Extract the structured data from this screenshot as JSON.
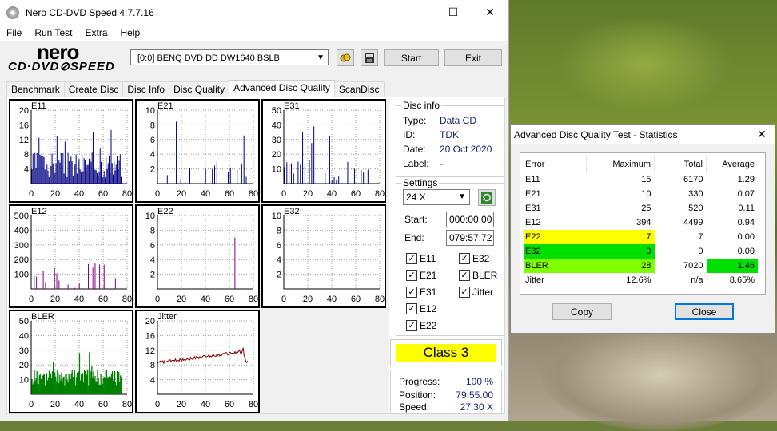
{
  "app": {
    "title": "Nero CD-DVD Speed 4.7.7.16",
    "logo_top": "nero",
    "logo_bottom": "CD·DVD⊘SPEED"
  },
  "window_controls": {
    "minimize": "—",
    "maximize": "☐",
    "close": "✕"
  },
  "menu": [
    "File",
    "Run Test",
    "Extra",
    "Help"
  ],
  "drive": {
    "selected": "[0:0]   BENQ DVD DD DW1640 BSLB"
  },
  "buttons": {
    "start": "Start",
    "exit": "Exit"
  },
  "tabs": [
    "Benchmark",
    "Create Disc",
    "Disc Info",
    "Disc Quality",
    "Advanced Disc Quality",
    "ScanDisc"
  ],
  "active_tab": 4,
  "disc_info": {
    "legend": "Disc info",
    "type_label": "Type:",
    "type": "Data CD",
    "id_label": "ID:",
    "id": "TDK",
    "date_label": "Date:",
    "date": "20 Oct 2020",
    "label_label": "Label:",
    "label": "-"
  },
  "settings": {
    "legend": "Settings",
    "speed": "24 X",
    "start_label": "Start:",
    "start": "000:00.00",
    "end_label": "End:",
    "end": "079:57.72",
    "checks": [
      {
        "label": "E11",
        "checked": true
      },
      {
        "label": "E32",
        "checked": true
      },
      {
        "label": "E21",
        "checked": true
      },
      {
        "label": "BLER",
        "checked": true
      },
      {
        "label": "E31",
        "checked": true
      },
      {
        "label": "Jitter",
        "checked": true
      },
      {
        "label": "E12",
        "checked": true
      },
      {
        "label": "E22",
        "checked": true
      }
    ]
  },
  "class": "Class 3",
  "progress": {
    "progress_label": "Progress:",
    "progress": "100 %",
    "position_label": "Position:",
    "position": "79:55.00",
    "speed_label": "Speed:",
    "speed": "27.30 X"
  },
  "graphs": [
    {
      "name": "E11",
      "yticks": [
        "20",
        "16",
        "12",
        "8",
        "4"
      ],
      "xticks": [
        "0",
        "20",
        "40",
        "60",
        "80"
      ],
      "color": "#000080"
    },
    {
      "name": "E21",
      "yticks": [
        "10",
        "8",
        "6",
        "4",
        "2"
      ],
      "xticks": [
        "0",
        "20",
        "40",
        "60",
        "80"
      ],
      "color": "#000080"
    },
    {
      "name": "E31",
      "yticks": [
        "50",
        "40",
        "30",
        "20",
        "10"
      ],
      "xticks": [
        "0",
        "20",
        "40",
        "60",
        "80"
      ],
      "color": "#000080"
    },
    {
      "name": "E12",
      "yticks": [
        "500",
        "400",
        "300",
        "200",
        "100"
      ],
      "xticks": [
        "0",
        "20",
        "40",
        "60",
        "80"
      ],
      "color": "#800080"
    },
    {
      "name": "E22",
      "yticks": [
        "10",
        "8",
        "6",
        "4",
        "2"
      ],
      "xticks": [
        "0",
        "20",
        "40",
        "60",
        "80"
      ],
      "color": "#800080"
    },
    {
      "name": "E32",
      "yticks": [
        "10",
        "8",
        "6",
        "4",
        "2"
      ],
      "xticks": [
        "0",
        "20",
        "40",
        "60",
        "80"
      ],
      "color": "#800080"
    },
    {
      "name": "BLER",
      "yticks": [
        "50",
        "40",
        "30",
        "20",
        "10"
      ],
      "xticks": [
        "0",
        "20",
        "40",
        "60",
        "80"
      ],
      "color": "#008000"
    },
    {
      "name": "Jitter",
      "yticks": [
        "20",
        "16",
        "12",
        "8",
        "4"
      ],
      "xticks": [
        "0",
        "20",
        "40",
        "60",
        "80"
      ],
      "color": "#800000"
    }
  ],
  "stats_dialog": {
    "title": "Advanced Disc Quality Test - Statistics",
    "close_x": "✕",
    "headers": [
      "Error",
      "Maximum",
      "Total",
      "Average"
    ],
    "rows": [
      {
        "error": "E11",
        "maximum": "15",
        "total": "6170",
        "average": "1.29",
        "hl_err": "",
        "hl_max": "",
        "hl_avg": ""
      },
      {
        "error": "E21",
        "maximum": "10",
        "total": "330",
        "average": "0.07",
        "hl_err": "",
        "hl_max": "",
        "hl_avg": ""
      },
      {
        "error": "E31",
        "maximum": "25",
        "total": "520",
        "average": "0.11",
        "hl_err": "",
        "hl_max": "",
        "hl_avg": ""
      },
      {
        "error": "E12",
        "maximum": "394",
        "total": "4499",
        "average": "0.94",
        "hl_err": "",
        "hl_max": "",
        "hl_avg": ""
      },
      {
        "error": "E22",
        "maximum": "7",
        "total": "7",
        "average": "0.00",
        "hl_err": "#ffff00",
        "hl_max": "#ffff00",
        "hl_avg": ""
      },
      {
        "error": "E32",
        "maximum": "0",
        "total": "0",
        "average": "0.00",
        "hl_err": "#00e000",
        "hl_max": "#00e000",
        "hl_avg": ""
      },
      {
        "error": "BLER",
        "maximum": "28",
        "total": "7020",
        "average": "1.46",
        "hl_err": "#80ff00",
        "hl_max": "#80ff00",
        "hl_avg": "#00e000"
      },
      {
        "error": "Jitter",
        "maximum": "12.6%",
        "total": "n/a",
        "average": "8.65%",
        "hl_err": "",
        "hl_max": "",
        "hl_avg": ""
      }
    ],
    "copy": "Copy",
    "close": "Close"
  }
}
